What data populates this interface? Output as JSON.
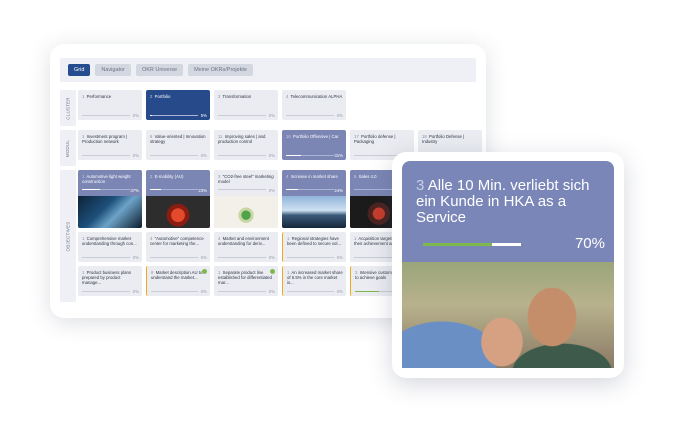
{
  "toolbar": {
    "buttons": [
      "Grid",
      "Navigator",
      "OKR Universe",
      "Meine OKRs/Projekte"
    ]
  },
  "rows": {
    "cluster": "CLUSTER",
    "model": "MODUL",
    "objectives": "OBJECTIVES"
  },
  "cluster_tiles": [
    {
      "num": "1",
      "title": "Performance",
      "pct": "0%"
    },
    {
      "num": "2",
      "title": "Portfolio",
      "pct": "5%"
    },
    {
      "num": "3",
      "title": "Transformation",
      "pct": "0%"
    },
    {
      "num": "4",
      "title": "Telecommunication ALPHA",
      "pct": "0%"
    }
  ],
  "model_tiles": [
    {
      "num": "1",
      "title": "Investment program | Production network",
      "pct": "0%"
    },
    {
      "num": "6",
      "title": "Value-oriented | Innovation strategy",
      "pct": "0%"
    },
    {
      "num": "11",
      "title": "Improving sales | and production control",
      "pct": "0%"
    },
    {
      "num": "16",
      "title": "Portfolio Offensive | Car",
      "pct": "31%"
    },
    {
      "num": "17",
      "title": "Portfolio defense | Packaging",
      "pct": "0%"
    },
    {
      "num": "18",
      "title": "Portfolio Defense | Industry",
      "pct": "0%"
    }
  ],
  "objective_tiles": [
    {
      "num": "1",
      "title": "Automotive light weight construction",
      "pct": "37%"
    },
    {
      "num": "2",
      "title": "E-mobility (AU)",
      "pct": "23%"
    },
    {
      "num": "3",
      "title": "\"CO2-free steel\" marketing model",
      "pct": "0%"
    },
    {
      "num": "4",
      "title": "Increase in market share",
      "pct": "24%"
    },
    {
      "num": "5",
      "title": "Sales 4.0",
      "pct": ""
    }
  ],
  "kr_tiles_row1": [
    {
      "num": "1",
      "title": "Comprehensive market understanding through con...",
      "pct": "0%"
    },
    {
      "num": "4",
      "title": "\"Automotive\" competence center for marketing the...",
      "pct": "0%"
    },
    {
      "num": "4",
      "title": "Market and environment understanding for deriv...",
      "pct": "0%"
    },
    {
      "num": "1",
      "title": "Regional strategies have been defined to secure vol...",
      "pct": "0%"
    },
    {
      "num": "1",
      "title": "Acquisition targets and their achievement are v...",
      "pct": "0%"
    }
  ],
  "kr_tiles_row2": [
    {
      "num": "1",
      "title": "Product business plans prepared by product manage...",
      "pct": "0%"
    },
    {
      "num": "8",
      "title": "Market description AU to understand the market...",
      "pct": "0%"
    },
    {
      "num": "1",
      "title": "Separate product line established for differentiated mar...",
      "pct": "0%"
    },
    {
      "num": "1",
      "title": "An increased market share of 6.5% in the core market is...",
      "pct": "0%"
    },
    {
      "num": "3",
      "title": "Intensive customer contact to achieve goals",
      "pct": "50%"
    }
  ],
  "overlay": {
    "num": "3",
    "title": "Alle 10 Min. verliebt sich ein Kunde in HKA as a Service",
    "pct": "70%",
    "progress": 0.7
  },
  "colors": {
    "accent": "#254c8e",
    "tile_mid": "#7b86b4",
    "progress_green": "#7fb84c",
    "warning_orange": "#f0a91d"
  }
}
